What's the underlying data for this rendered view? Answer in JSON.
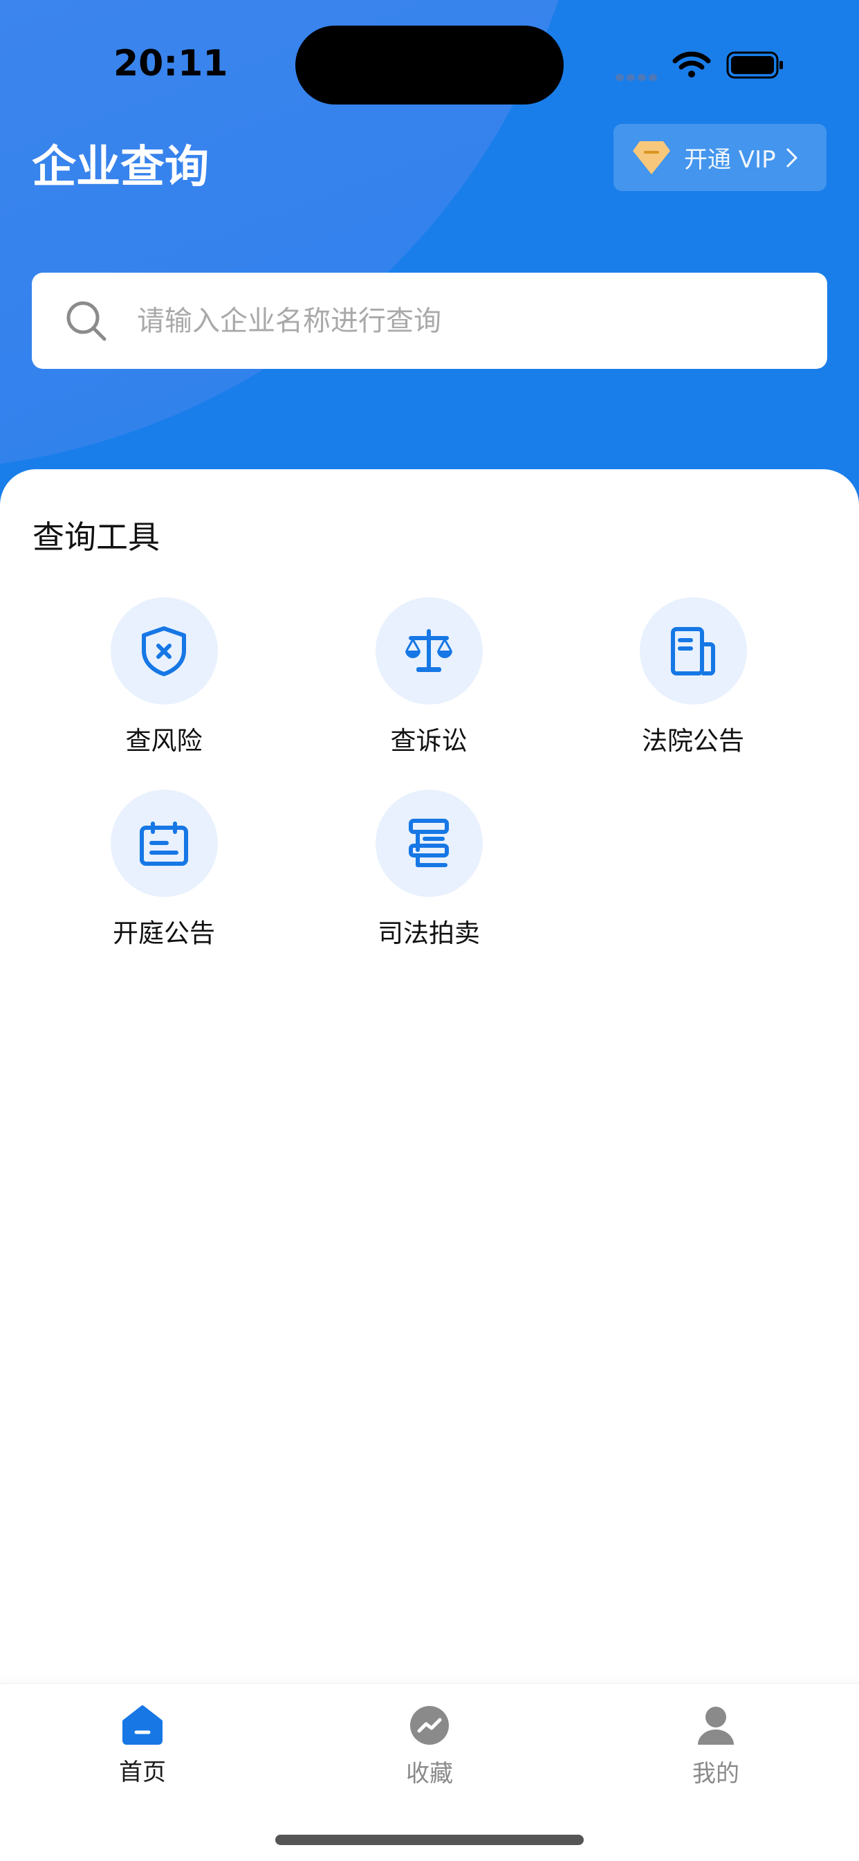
{
  "status_bar": {
    "time": "20:11"
  },
  "header": {
    "title": "企业查询",
    "vip_label": "开通 VIP"
  },
  "search": {
    "placeholder": "请输入企业名称进行查询"
  },
  "tools_section": {
    "title": "查询工具",
    "items": [
      {
        "label": "查风险",
        "icon": "shield-x-icon"
      },
      {
        "label": "查诉讼",
        "icon": "scale-icon"
      },
      {
        "label": "法院公告",
        "icon": "document-icon"
      },
      {
        "label": "开庭公告",
        "icon": "calendar-icon"
      },
      {
        "label": "司法拍卖",
        "icon": "gavel-icon"
      }
    ]
  },
  "tab_bar": {
    "items": [
      {
        "label": "首页",
        "icon": "home-icon",
        "active": true
      },
      {
        "label": "收藏",
        "icon": "trend-icon",
        "active": false
      },
      {
        "label": "我的",
        "icon": "user-icon",
        "active": false
      }
    ]
  },
  "colors": {
    "primary": "#1677e5",
    "header": "#1a7eea",
    "icon_bg": "#e8f1fd",
    "inactive": "#8a8a8a",
    "vip_gold": "#f7c77c"
  }
}
